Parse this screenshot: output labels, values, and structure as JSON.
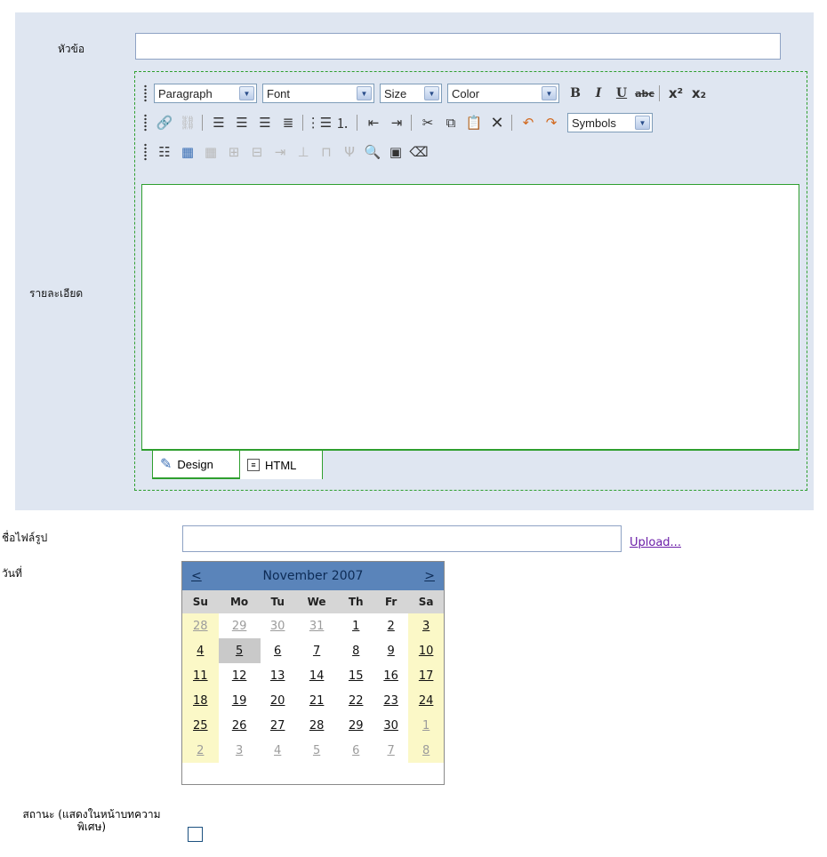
{
  "form": {
    "title_label": "หัวข้อ",
    "title_value": "",
    "detail_label": "รายละเอียด",
    "image_label": "ชื่อไฟล์รูป",
    "image_value": "",
    "upload_link": "Upload...",
    "date_label": "วันที่",
    "status_label": "สถานะ (แสดงในหน้าบทความพิเศษ)",
    "status_checked": false
  },
  "editor": {
    "paragraph": "Paragraph",
    "font": "Font",
    "size": "Size",
    "color": "Color",
    "symbols": "Symbols",
    "bold": "B",
    "italic": "I",
    "underline": "U",
    "strike": "abc",
    "tabs": [
      "Design",
      "HTML"
    ],
    "active_tab": "Design"
  },
  "calendar": {
    "prev": "<",
    "next": ">",
    "month_title": "November 2007",
    "weekdays": [
      "Su",
      "Mo",
      "Tu",
      "We",
      "Th",
      "Fr",
      "Sa"
    ],
    "weeks": [
      [
        "28",
        "29",
        "30",
        "31",
        "1",
        "2",
        "3"
      ],
      [
        "4",
        "5",
        "6",
        "7",
        "8",
        "9",
        "10"
      ],
      [
        "11",
        "12",
        "13",
        "14",
        "15",
        "16",
        "17"
      ],
      [
        "18",
        "19",
        "20",
        "21",
        "22",
        "23",
        "24"
      ],
      [
        "25",
        "26",
        "27",
        "28",
        "29",
        "30",
        "1"
      ],
      [
        "2",
        "3",
        "4",
        "5",
        "6",
        "7",
        "8"
      ]
    ],
    "selected_day": "5"
  },
  "colors": {
    "panel_bg": "#dfe6f1",
    "editor_border": "#2f9f2f",
    "calendar_header": "#5a84ba",
    "weekend_bg": "#fbf8c7",
    "link": "#6b1fa8"
  }
}
